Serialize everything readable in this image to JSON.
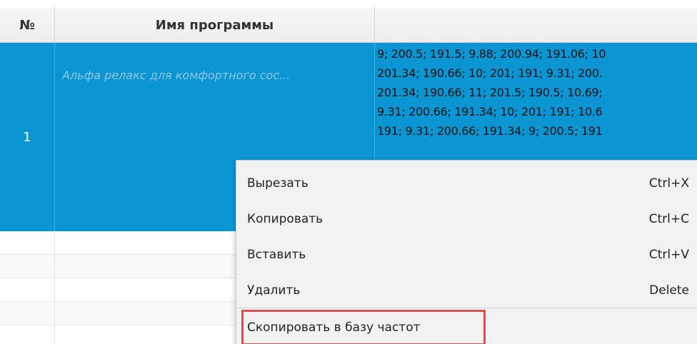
{
  "table": {
    "headers": {
      "number": "№",
      "program_name": "Имя программы",
      "frequencies": ""
    },
    "selected_row": {
      "number": "1",
      "name": "Альфа релакс для комфортного сос...",
      "frequency_lines": [
        "9; 200.5; 191.5; 9.88; 200.94; 191.06; 10",
        "201.34; 190.66; 10; 201; 191; 9.31; 200.",
        "201.34; 190.66; 11; 201.5; 190.5; 10.69;",
        "9.31; 200.66; 191.34; 10; 201; 191; 10.6",
        "191; 9.31; 200.66; 191.34; 9; 200.5; 191"
      ]
    }
  },
  "context_menu": {
    "items": [
      {
        "label": "Вырезать",
        "shortcut": "Ctrl+X"
      },
      {
        "label": "Копировать",
        "shortcut": "Ctrl+C"
      },
      {
        "label": "Вставить",
        "shortcut": "Ctrl+V"
      },
      {
        "label": "Удалить",
        "shortcut": "Delete"
      }
    ],
    "special_item": {
      "label": "Скопировать в  базу частот"
    }
  },
  "colors": {
    "selection": "#0b96d3",
    "highlight_border": "#d8504f"
  }
}
